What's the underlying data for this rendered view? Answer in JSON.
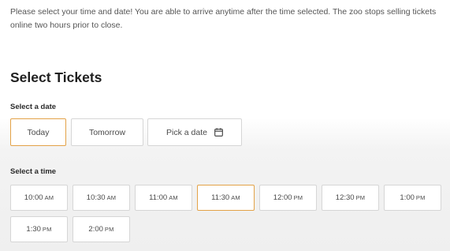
{
  "intro": "Please select your time and date! You are able to arrive anytime after the time selected. The zoo stops selling tickets online two hours prior to close.",
  "section_title": "Select Tickets",
  "date_label": "Select a date",
  "date_buttons": [
    {
      "label": "Today",
      "selected": true
    },
    {
      "label": "Tomorrow",
      "selected": false
    },
    {
      "label": "Pick a date",
      "icon": "calendar-icon",
      "selected": false
    }
  ],
  "time_label": "Select a time",
  "times": [
    {
      "time": "10:00",
      "ampm": "AM",
      "selected": false
    },
    {
      "time": "10:30",
      "ampm": "AM",
      "selected": false
    },
    {
      "time": "11:00",
      "ampm": "AM",
      "selected": false
    },
    {
      "time": "11:30",
      "ampm": "AM",
      "selected": true
    },
    {
      "time": "12:00",
      "ampm": "PM",
      "selected": false
    },
    {
      "time": "12:30",
      "ampm": "PM",
      "selected": false
    },
    {
      "time": "1:00",
      "ampm": "PM",
      "selected": false
    },
    {
      "time": "1:30",
      "ampm": "PM",
      "selected": false
    },
    {
      "time": "2:00",
      "ampm": "PM",
      "selected": false
    }
  ],
  "colors": {
    "selected_border": "#e3a247",
    "default_border": "#d6d6d6"
  }
}
